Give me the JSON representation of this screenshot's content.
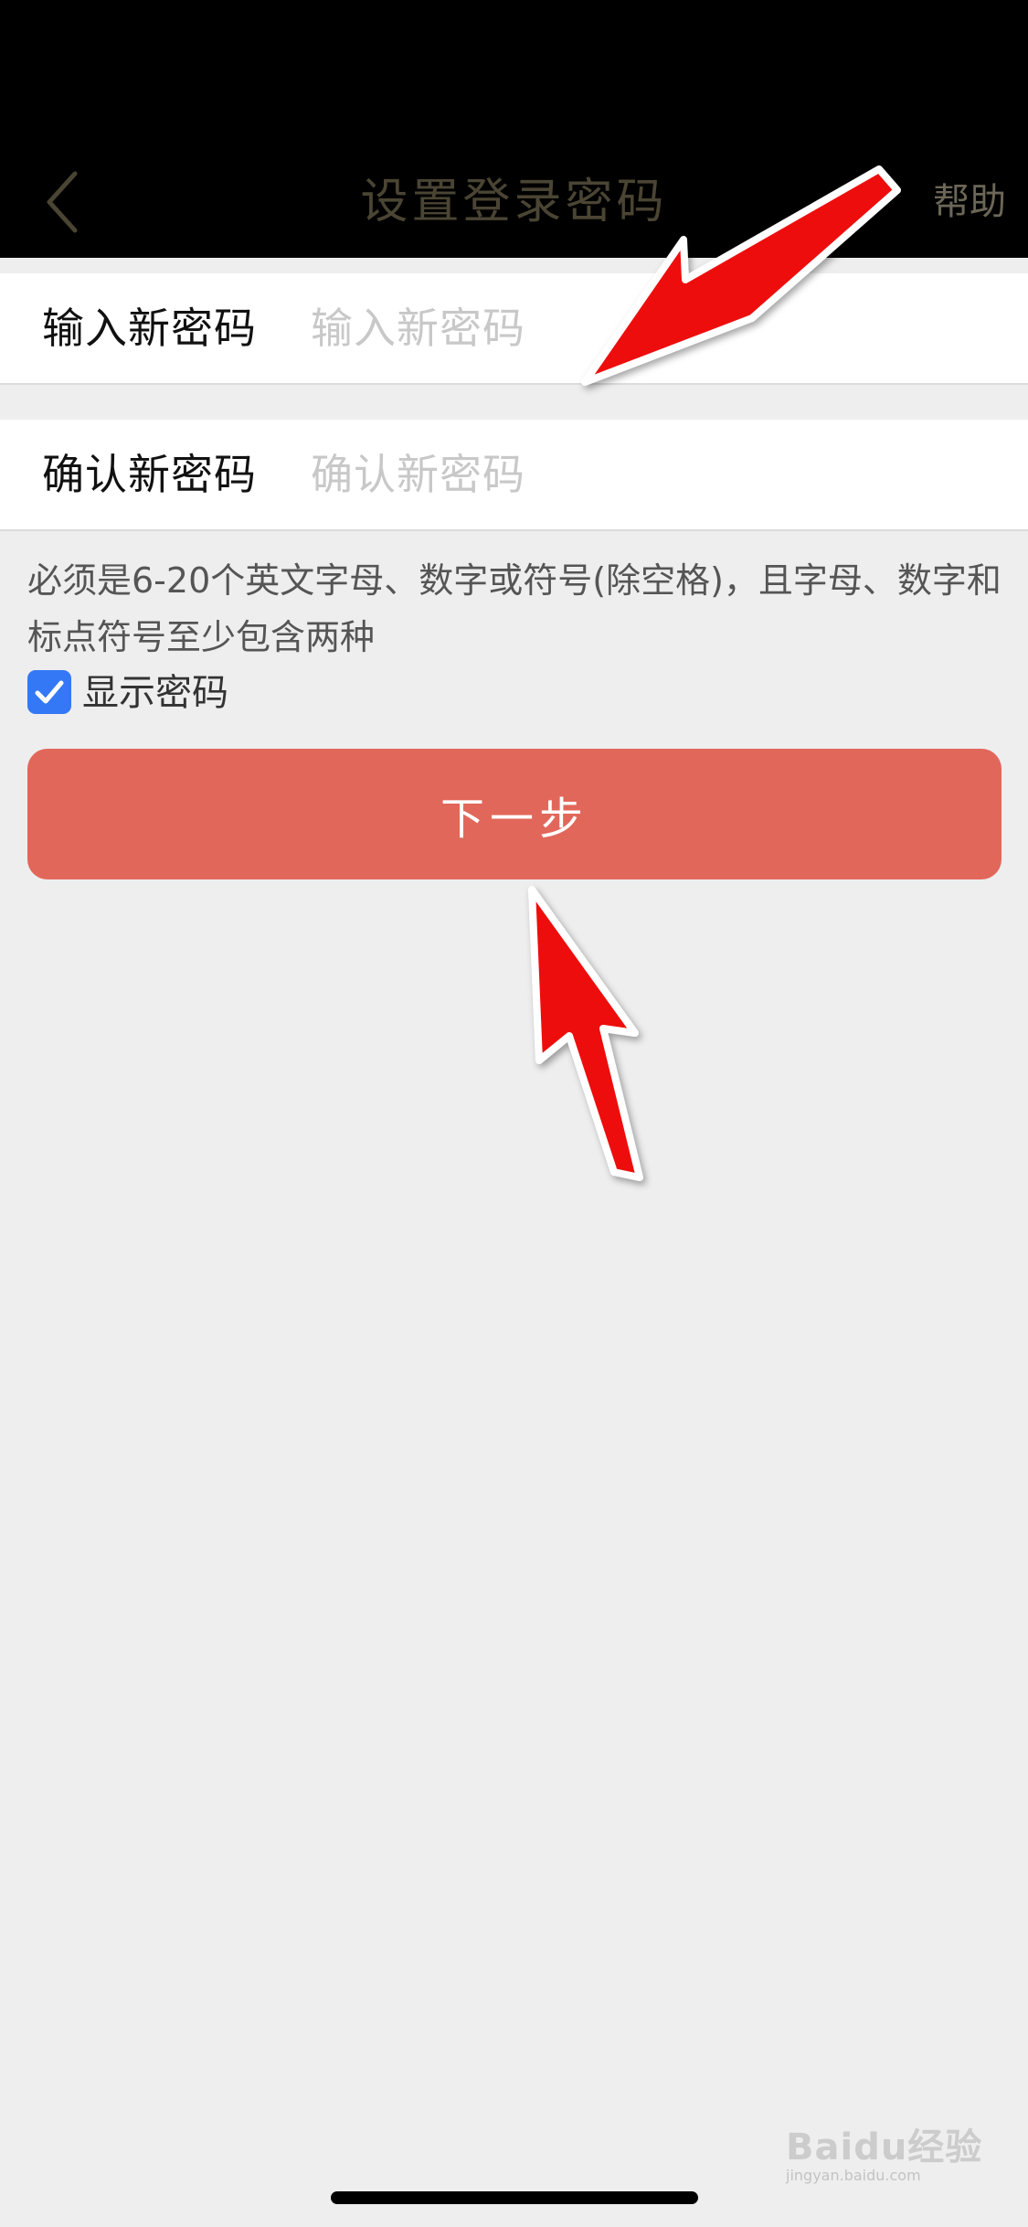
{
  "header": {
    "title": "设置登录密码",
    "help_label": "帮助",
    "back_icon": "chevron-left-icon"
  },
  "form": {
    "new_password": {
      "label": "输入新密码",
      "placeholder": "输入新密码",
      "value": ""
    },
    "confirm_password": {
      "label": "确认新密码",
      "placeholder": "确认新密码",
      "value": ""
    },
    "hint": "必须是6-20个英文字母、数字或符号(除空格)，且字母、数字和标点符号至少包含两种",
    "show_password": {
      "label": "显示密码",
      "checked": true
    },
    "next_button": "下一步"
  },
  "watermark": {
    "brand": "Baidu经验",
    "url": "jingyan.baidu.com"
  },
  "colors": {
    "status_bar": "#000000",
    "nav_bar": "#000000",
    "nav_title": "#4a4433",
    "help_text": "#6b6657",
    "background": "#eeeeee",
    "primary_button": "#e2675b",
    "button_text": "#ffffff",
    "checkbox": "#3478f6",
    "annotation_arrow": "#ee1111"
  }
}
